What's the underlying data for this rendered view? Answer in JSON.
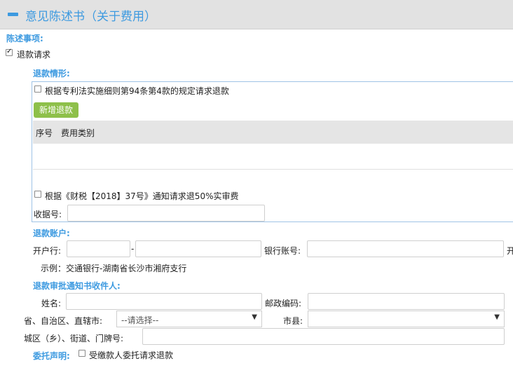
{
  "header": {
    "title": "意见陈述书（关于费用）"
  },
  "statement": {
    "label": "陈述事项:",
    "refund_request_label": "退款请求",
    "refund_request_checked": true
  },
  "refund_situation": {
    "label": "退款情形:",
    "rule94_label": "根据专利法实施细则第94条第4款的规定请求退款",
    "add_refund_button": "新增退款",
    "table_headers": [
      "序号",
      "费用类别"
    ],
    "rule2018_label": "根据《财税【2018】37号》通知请求退50%实审费",
    "receipt_label": "收据号:",
    "receipt_value": ""
  },
  "refund_account": {
    "label": "退款账户:",
    "bank_label": "开户行:",
    "bank_value_1": "",
    "dash": "-",
    "bank_value_2": "",
    "account_label": "银行账号:",
    "account_value": "",
    "overflow_char": "开",
    "example": "示例：交通银行-湖南省长沙市湘府支行"
  },
  "recipient": {
    "label": "退款审批通知书收件人:",
    "name_label": "姓名:",
    "name_value": "",
    "postcode_label": "邮政编码:",
    "postcode_value": "",
    "province_label": "省、自治区、直辖市:",
    "province_selected": "--请选择--",
    "city_label": "市县:",
    "city_selected": "",
    "address_label": "城区（乡）、街道、门牌号:",
    "address_value": ""
  },
  "entrust": {
    "label": "委托声明:",
    "checkbox_label": "受缴款人委托请求退款",
    "checked": false
  }
}
